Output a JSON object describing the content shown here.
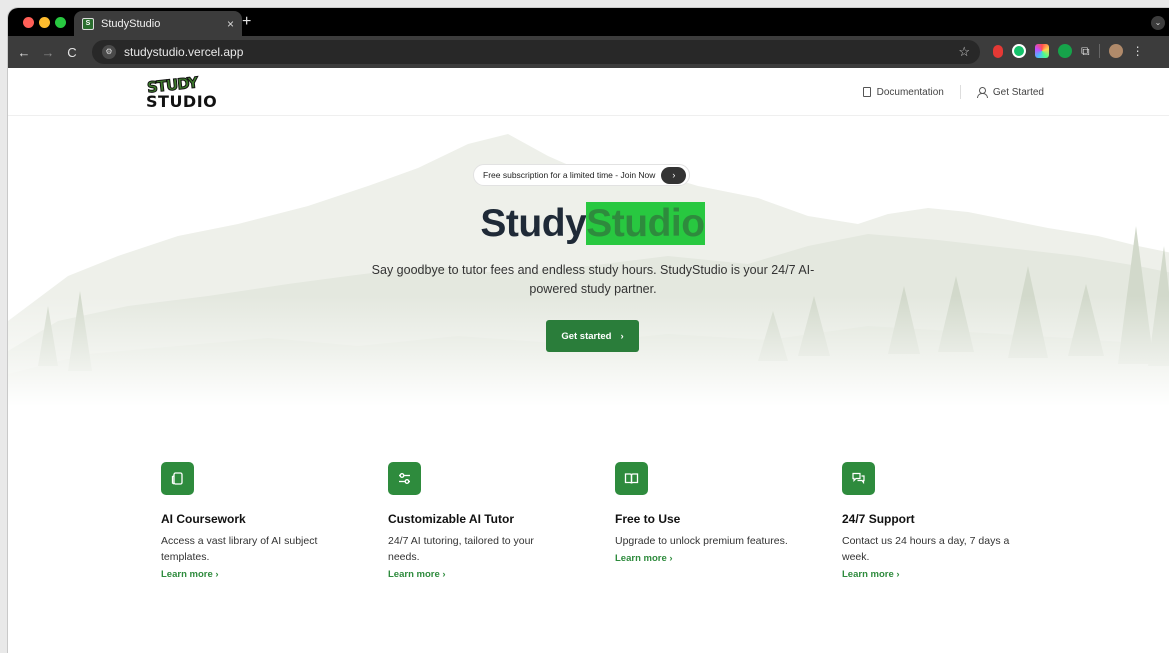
{
  "browser": {
    "tab_title": "StudyStudio",
    "tab_close": "×",
    "new_tab": "+",
    "url": "studystudio.vercel.app",
    "nav": {
      "back": "←",
      "forward": "→",
      "reload": "C"
    }
  },
  "header": {
    "logo_top": "STUDY",
    "logo_bottom": "STUDIO",
    "nav": [
      {
        "label": "Documentation",
        "icon": "document-icon"
      },
      {
        "label": "Get Started",
        "icon": "user-icon"
      }
    ]
  },
  "hero": {
    "announcement": "Free subscription for a limited time - Join Now",
    "announcement_arrow": "›",
    "title_part1": "Study",
    "title_part2": "Studio",
    "subtitle": "Say goodbye to tutor fees and endless study hours. StudyStudio is your 24/7 AI-powered study partner.",
    "cta_label": "Get started",
    "cta_arrow": "›"
  },
  "features": [
    {
      "icon": "folder-copy-icon",
      "title": "AI Coursework",
      "description": "Access a vast library of AI subject templates.",
      "link": "Learn more ›"
    },
    {
      "icon": "sliders-icon",
      "title": "Customizable AI Tutor",
      "description": "24/7 AI tutoring, tailored to your needs.",
      "link": "Learn more ›"
    },
    {
      "icon": "book-open-icon",
      "title": "Free to Use",
      "description": "Upgrade to unlock premium features.",
      "link": "Learn more ›"
    },
    {
      "icon": "chat-bubbles-icon",
      "title": "24/7 Support",
      "description": "Contact us 24 hours a day, 7 days a week.",
      "link": "Learn more ›"
    }
  ],
  "colors": {
    "brand_green": "#2e8b3d",
    "cta_green": "#2a7d3a",
    "title_dark": "#1f2a37"
  }
}
